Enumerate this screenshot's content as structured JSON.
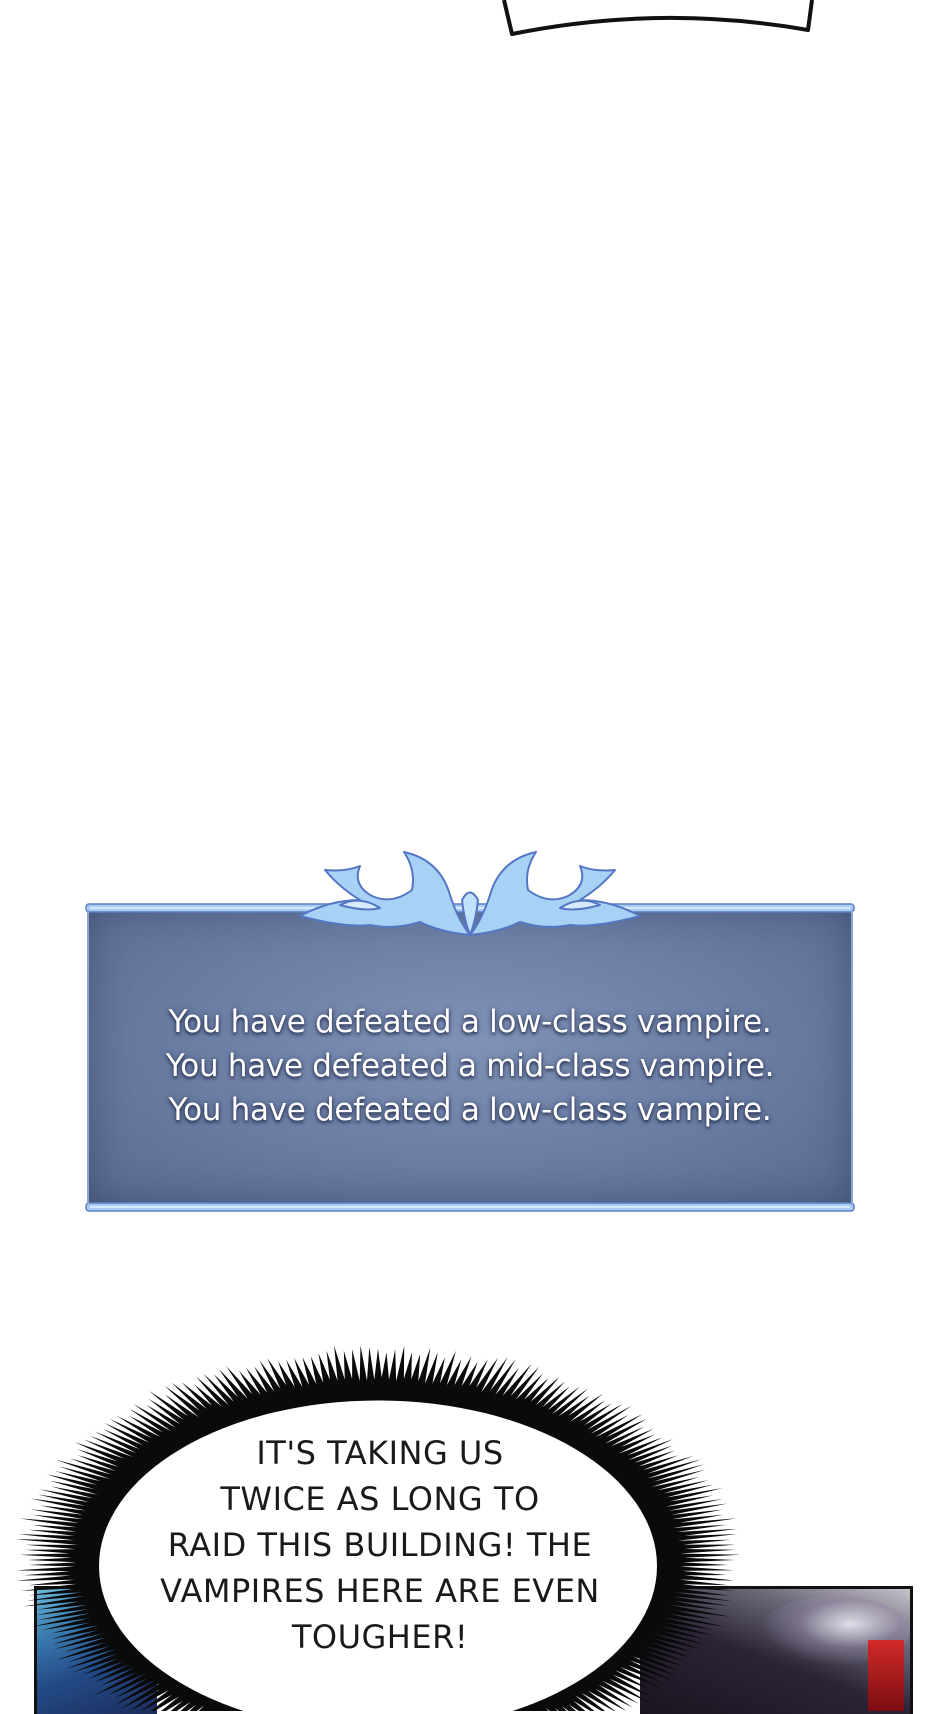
{
  "system_panel": {
    "lines": [
      "You have defeated a low-class vampire.",
      "You have defeated a mid-class vampire.",
      "You have defeated a low-class vampire."
    ],
    "colors": {
      "panel": "#6a7ca2",
      "frame": "#8fbbe8",
      "text": "#ffffff"
    }
  },
  "speech_bubble": {
    "lines": [
      "IT'S TAKING US",
      "TWICE AS LONG TO",
      "RAID THIS BUILDING! THE",
      "VAMPIRES HERE ARE EVEN",
      "TOUGHER!"
    ]
  }
}
